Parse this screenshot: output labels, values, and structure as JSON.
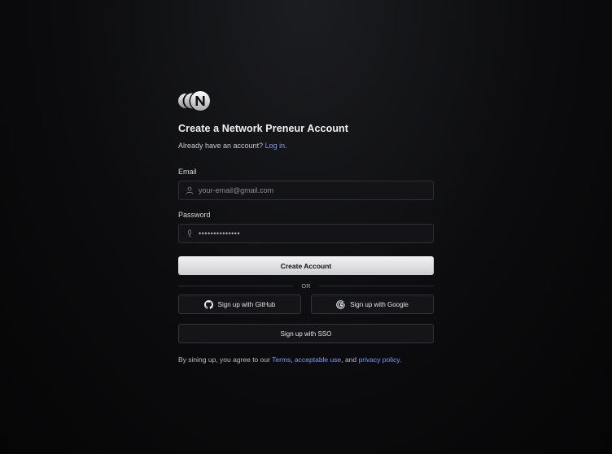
{
  "header": {
    "logo_name": "network-preneur-logo",
    "title": "Create a  Network Preneur Account",
    "subtitle_text": "Already have an account?",
    "login_link": "Log in."
  },
  "form": {
    "email_label": "Email",
    "email_placeholder": "your-email@gmail.com",
    "password_label": "Password",
    "password_value": "••••••••••••••",
    "create_button": "Create  Account"
  },
  "divider": {
    "label": "OR"
  },
  "social": {
    "github_label": "Sign up with GitHub",
    "google_label": "Sign up with Google",
    "sso_label": "Sign up with SSO"
  },
  "footer": {
    "prefix": "By sining up, you agree to our",
    "terms": "Terms",
    "sep1": ",",
    "acceptable": "acceptable use",
    "sep2": ", and",
    "privacy": "privacy policy",
    "suffix": "."
  },
  "colors": {
    "accent": "#7e9cf5",
    "background": "#0c0c0e",
    "button_primary": "#e5e5e7"
  },
  "icons": [
    "user-icon",
    "key-icon",
    "github-icon",
    "google-icon"
  ]
}
